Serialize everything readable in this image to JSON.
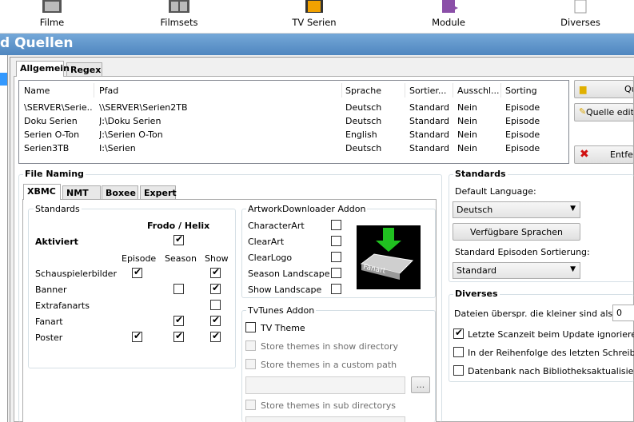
{
  "toolbar": {
    "items": [
      {
        "label": "Filme",
        "icon": "film-icon"
      },
      {
        "label": "Filmsets",
        "icon": "filmsets-icon"
      },
      {
        "label": "TV Serien",
        "icon": "tv-series-icon"
      },
      {
        "label": "Module",
        "icon": "puzzle-icon"
      },
      {
        "label": "Diverses",
        "icon": "document-icon"
      }
    ]
  },
  "title": "d Quellen",
  "tabs_top": {
    "allgemein": "Allgemein",
    "regex": "Regex"
  },
  "sources": {
    "headers": [
      "Name",
      "Pfad",
      "Sprache",
      "Sortier...",
      "Ausschl...",
      "Sorting"
    ],
    "rows": [
      [
        "\\SERVER\\Serie...",
        "\\\\SERVER\\Serien2TB",
        "Deutsch",
        "Standard",
        "Nein",
        "Episode"
      ],
      [
        "Doku Serien",
        "J:\\Doku Serien",
        "Deutsch",
        "Standard",
        "Nein",
        "Episode"
      ],
      [
        "Serien O-Ton",
        "J:\\Serien O-Ton",
        "English",
        "Standard",
        "Nein",
        "Episode"
      ],
      [
        "Serien3TB",
        "I:\\Serien",
        "Deutsch",
        "Standard",
        "Nein",
        "Episode"
      ]
    ]
  },
  "buttons": {
    "add": "Qu",
    "edit": "Quelle editi",
    "remove": "Entfer"
  },
  "file_naming": {
    "title": "File Naming",
    "tabs": {
      "xbmc": "XBMC",
      "nmt": "NMT",
      "boxee": "Boxee",
      "expert": "Expert"
    },
    "standards_title": "Standards",
    "frodo": "Frodo / Helix",
    "aktiviert": "Aktiviert",
    "cols": {
      "episode": "Episode",
      "season": "Season",
      "show": "Show"
    },
    "rows": [
      {
        "label": "Schauspielerbilder",
        "episode": true,
        "season": null,
        "show": true
      },
      {
        "label": "Banner",
        "episode": null,
        "season": false,
        "show": true
      },
      {
        "label": "Extrafanarts",
        "episode": null,
        "season": null,
        "show": false
      },
      {
        "label": "Fanart",
        "episode": null,
        "season": true,
        "show": true
      },
      {
        "label": "Poster",
        "episode": true,
        "season": true,
        "show": true
      }
    ],
    "artwork_title": "ArtworkDownloader Addon",
    "artwork_items": [
      "CharacterArt",
      "ClearArt",
      "ClearLogo",
      "Season Landscape",
      "Show Landscape"
    ],
    "artwork_logo_text": "Fanart",
    "tvtunes_title": "TvTunes Addon",
    "tvtunes": {
      "theme": "TV Theme",
      "show_dir": "Store themes in show directory",
      "custom": "Store themes in a custom path",
      "browse": "...",
      "sub": "Store themes in sub directorys"
    }
  },
  "standards": {
    "title": "Standards",
    "default_language_label": "Default Language:",
    "default_language": "Deutsch",
    "available_languages_btn": "Verfügbare Sprachen",
    "episode_sort_label": "Standard Episoden Sortierung:",
    "episode_sort": "Standard"
  },
  "diverses": {
    "title": "Diverses",
    "skip_label": "Dateien überspr. die kleiner sind als:",
    "skip_value": "0",
    "opt1": "Letzte Scanzeit beim Update ignorieren",
    "opt2": "In der Reihenfolge des letzten Schreibvo",
    "opt3": "Datenbank nach Bibliotheksaktualisierun"
  }
}
